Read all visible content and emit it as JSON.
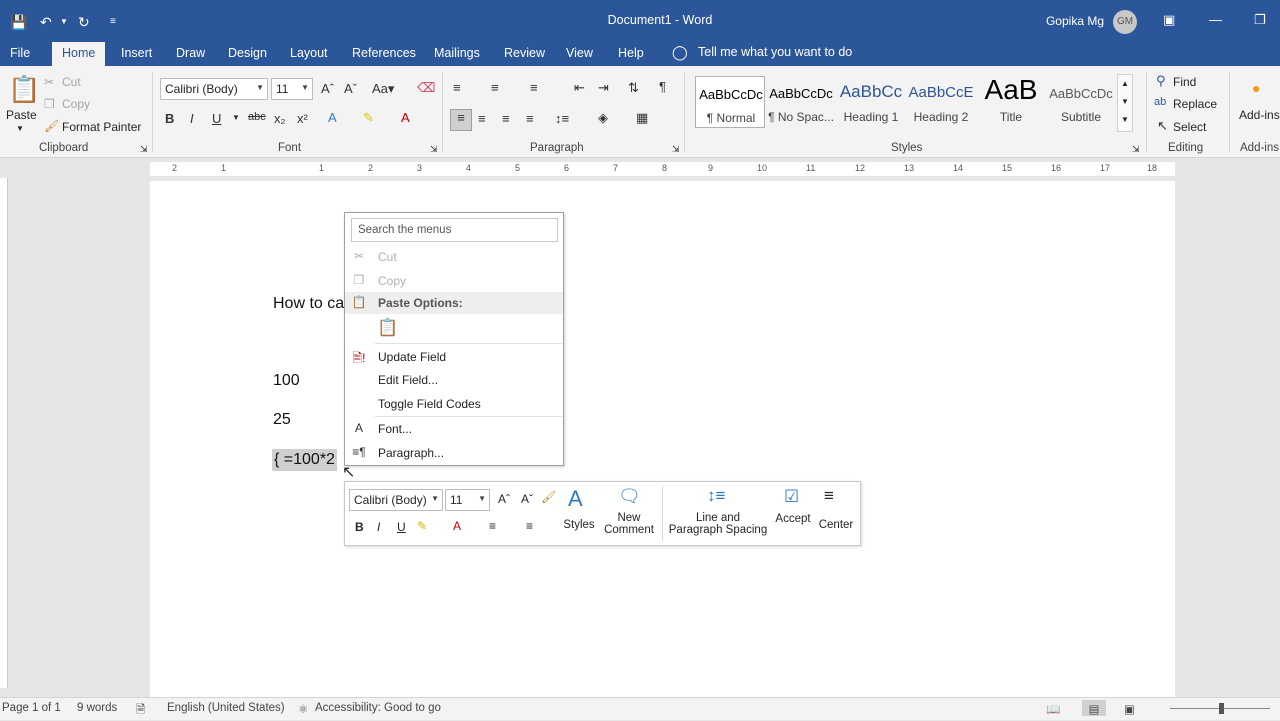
{
  "titlebar": {
    "doc_title": "Document1  -  Word",
    "user": "Gopika Mg",
    "avatar_initials": "GM",
    "color": "#2b579a"
  },
  "tabs": [
    "File",
    "Home",
    "Insert",
    "Draw",
    "Design",
    "Layout",
    "References",
    "Mailings",
    "Review",
    "View",
    "Help"
  ],
  "tell_me": "Tell me what you want to do",
  "ribbon": {
    "clipboard": {
      "label": "Clipboard",
      "paste": "Paste",
      "cut": "Cut",
      "copy": "Copy",
      "format_painter": "Format Painter"
    },
    "font": {
      "label": "Font",
      "font_name": "Calibri (Body)",
      "font_size": "11"
    },
    "paragraph": {
      "label": "Paragraph"
    },
    "styles": {
      "label": "Styles",
      "items": [
        {
          "sample": "AaBbCcDc",
          "name": "¶ Normal"
        },
        {
          "sample": "AaBbCcDc",
          "name": "¶ No Spac..."
        },
        {
          "sample": "AaBbCc",
          "name": "Heading 1"
        },
        {
          "sample": "AaBbCcE",
          "name": "Heading 2"
        },
        {
          "sample": "AaB",
          "name": "Title"
        },
        {
          "sample": "AaBbCcDc",
          "name": "Subtitle"
        }
      ]
    },
    "editing": {
      "label": "Editing",
      "find": "Find",
      "replace": "Replace",
      "select": "Select"
    },
    "addins": {
      "label": "Add-ins",
      "button": "Add-ins"
    }
  },
  "ruler": [
    "2",
    "1",
    "1",
    "2",
    "3",
    "4",
    "5",
    "6",
    "7",
    "8",
    "9",
    "10",
    "11",
    "12",
    "13",
    "14",
    "15",
    "16",
    "17",
    "18"
  ],
  "document": {
    "line1": "How to ca",
    "value1": "100",
    "value2": "25",
    "field_code": "{ =100*2"
  },
  "context_menu": {
    "search_placeholder": "Search the menus",
    "cut": "Cut",
    "copy": "Copy",
    "paste_options": "Paste Options:",
    "update_field": "Update Field",
    "edit_field": "Edit Field...",
    "toggle_field_codes": "Toggle Field Codes",
    "font": "Font...",
    "paragraph": "Paragraph..."
  },
  "mini_toolbar": {
    "font_name": "Calibri (Body)",
    "font_size": "11",
    "styles": "Styles",
    "new_comment_1": "New",
    "new_comment_2": "Comment",
    "line_spacing_1": "Line and",
    "line_spacing_2": "Paragraph Spacing",
    "accept": "Accept",
    "center": "Center"
  },
  "statusbar": {
    "page": "Page 1 of 1",
    "words": "9 words",
    "language": "English (United States)",
    "accessibility": "Accessibility: Good to go"
  }
}
